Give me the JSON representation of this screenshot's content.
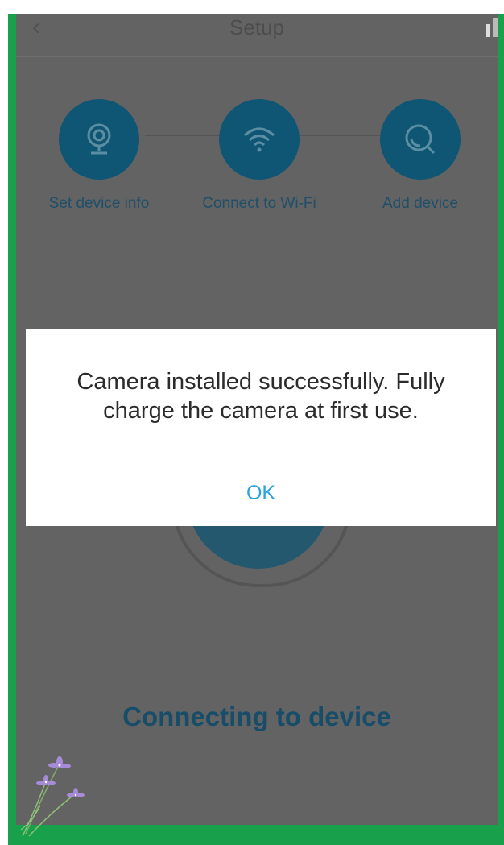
{
  "header": {
    "back_icon": "chevron-left-icon",
    "title": "Setup"
  },
  "steps": [
    {
      "label": "Set device info",
      "icon": "camera-icon"
    },
    {
      "label": "Connect to Wi-Fi",
      "icon": "wifi-icon"
    },
    {
      "label": "Add device",
      "icon": "search-icon"
    }
  ],
  "progress": {
    "status_text": "Connecting to device"
  },
  "dialog": {
    "message": "Camera installed successfully. Fully charge the camera at first use.",
    "ok_label": "OK"
  },
  "colors": {
    "frame": "#18a14a",
    "overlay": "#636363",
    "step_circle": "#0f5574",
    "step_label": "#1f4f69",
    "ok_text": "#2aa4dd"
  }
}
